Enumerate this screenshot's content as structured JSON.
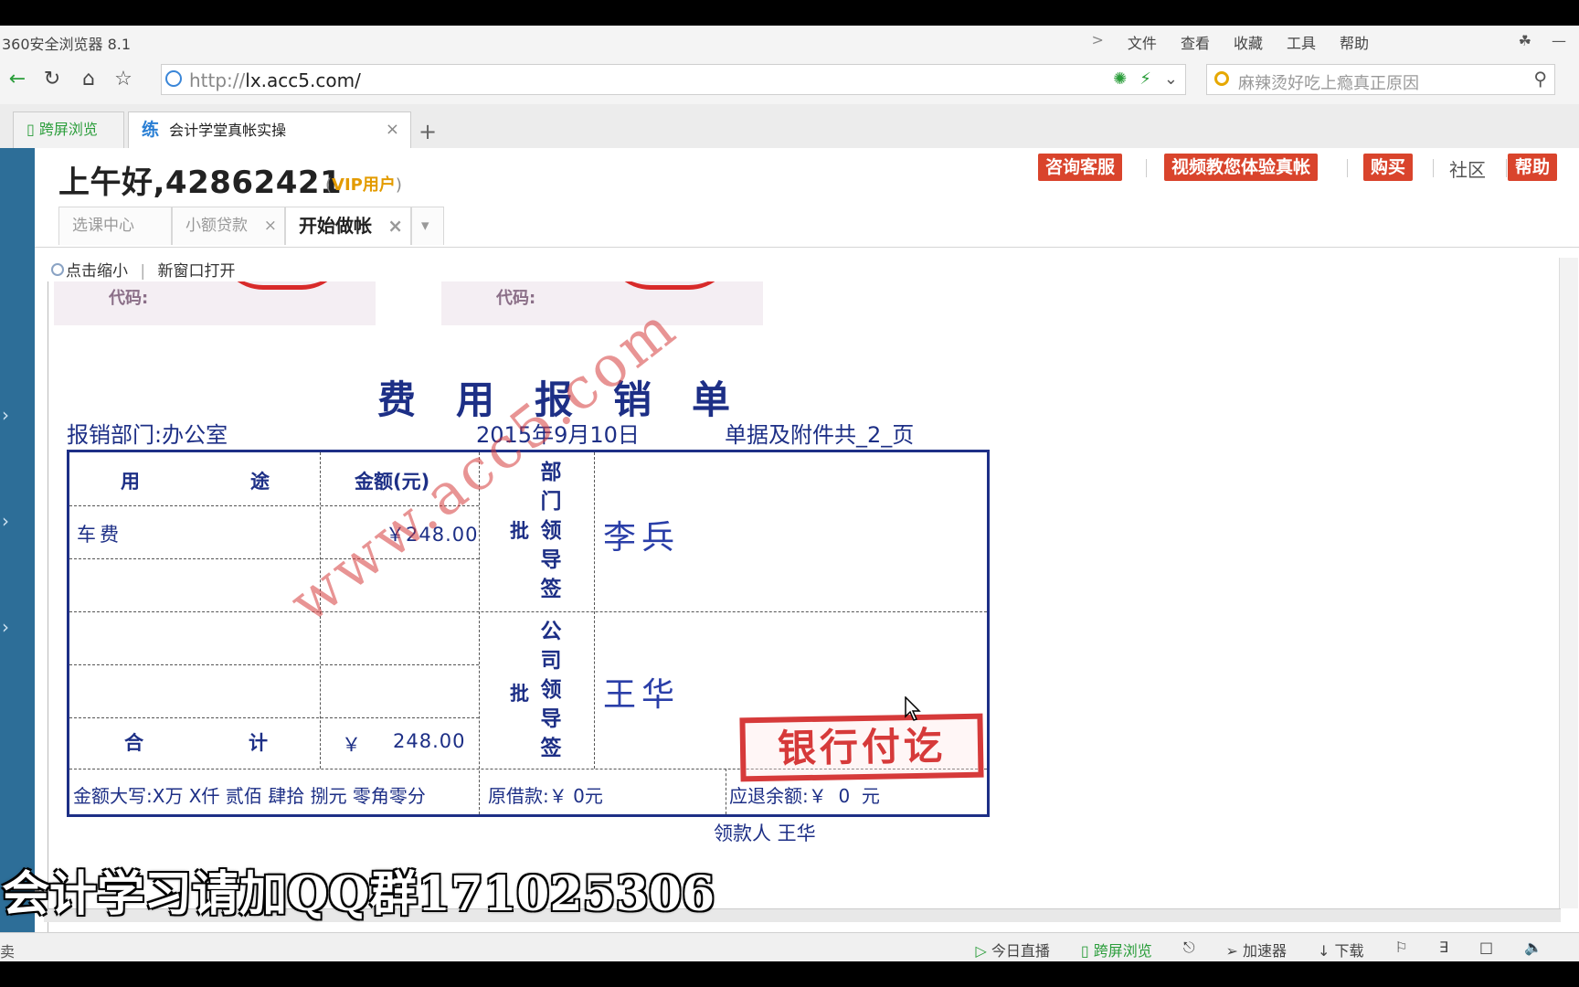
{
  "browser": {
    "title": "360安全浏览器 8.1",
    "menu": [
      ">",
      "文件",
      "查看",
      "收藏",
      "工具",
      "帮助"
    ],
    "url_prefix": "http://",
    "url_host": "lx.acc5.com/",
    "search_placeholder": "麻辣烫好吃上瘾真正原因",
    "tabs": [
      {
        "label": "跨屏浏览"
      },
      {
        "icon_text": "练",
        "label": "会计学堂真帐实操",
        "close": "×"
      }
    ],
    "newtab": "+"
  },
  "site": {
    "greeting": "上午好,42862421",
    "vip_open": "(",
    "vip": "VIP用户",
    "vip_close": ")",
    "buttons": [
      "咨询客服",
      "视频教您体验真帐",
      "购买"
    ],
    "community": "社区",
    "help": "帮助",
    "inner_tabs": [
      {
        "label": "选课中心"
      },
      {
        "label": "小额贷款",
        "close": "×"
      },
      {
        "label": "开始做帐",
        "close": "×"
      }
    ],
    "dropdown": "▾",
    "view_tools": {
      "zoom": "点击缩小",
      "sep": "|",
      "new_window": "新窗口打开"
    }
  },
  "doc": {
    "stamp_code_label": "代码:",
    "title": "费用报销单",
    "dept": "报销部门:办公室",
    "date": "2015年9月10日",
    "attachments": "单据及附件共_2_页",
    "col_use": "用",
    "col_use2": "途",
    "col_amount": "金额(元)",
    "row1_use": "车费",
    "row1_amount": "￥248.00",
    "total_label1": "合",
    "total_label2": "计",
    "total_currency": "￥",
    "total_amount": "248.00",
    "approve_label": "批",
    "dept_leader_chars": [
      "部",
      "门",
      "领",
      "导",
      "签"
    ],
    "company_leader_chars": [
      "公",
      "司",
      "领",
      "导",
      "签"
    ],
    "dept_signer": "李兵",
    "company_signer": "王华",
    "amount_words": "金额大写:X万 X仟 贰佰 肆拾 捌元 零角零分",
    "advance": "原借款:￥ 0元",
    "refund": "应退余额:￥  0  元",
    "receiver": "领款人 王华",
    "watermark": "www.acc5.com",
    "bank_stamp": "银行付讫"
  },
  "overlay_text": "会计学习请加QQ群171025306",
  "status": {
    "left": "卖",
    "items": [
      "今日直播",
      "跨屏浏览",
      "加速器",
      "下载"
    ]
  }
}
